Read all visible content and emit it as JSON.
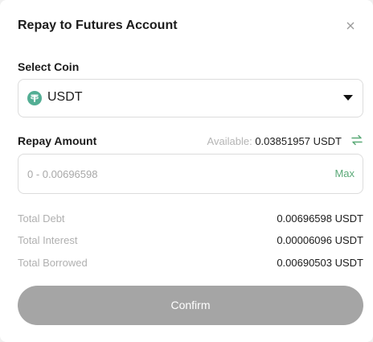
{
  "dialog": {
    "title": "Repay to Futures Account",
    "close_icon": "close-icon"
  },
  "coin": {
    "label": "Select Coin",
    "selected": "USDT",
    "icon": "usdt-coin-icon",
    "icon_color": "#53ae94"
  },
  "repay": {
    "label": "Repay Amount",
    "available_label": "Available:",
    "available_value": "0.03851957 USDT",
    "swap_icon": "swap-arrows-icon",
    "placeholder": "0 - 0.00696598",
    "value": "",
    "max_label": "Max"
  },
  "summary": [
    {
      "label": "Total Debt",
      "value": "0.00696598 USDT"
    },
    {
      "label": "Total Interest",
      "value": "0.00006096 USDT"
    },
    {
      "label": "Total Borrowed",
      "value": "0.00690503 USDT"
    }
  ],
  "confirm_label": "Confirm",
  "colors": {
    "accent": "#5aa977",
    "disabled_button": "#a5a5a5"
  }
}
